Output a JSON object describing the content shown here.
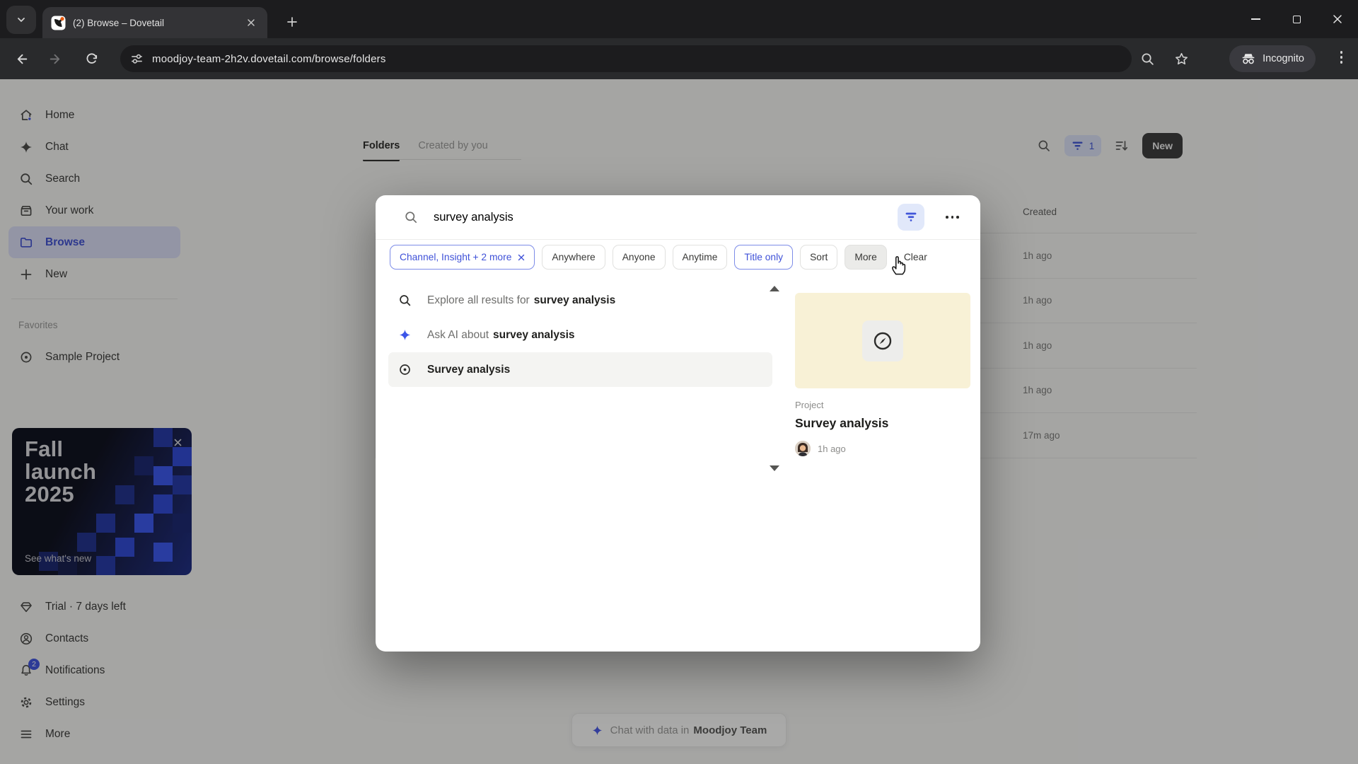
{
  "browser": {
    "tab_title": "(2) Browse – Dovetail",
    "url": "moodjoy-team-2h2v.dovetail.com/browse/folders",
    "incognito_label": "Incognito"
  },
  "sidebar": {
    "items": [
      {
        "label": "Home",
        "icon": "home-icon"
      },
      {
        "label": "Chat",
        "icon": "sparkle-icon"
      },
      {
        "label": "Search",
        "icon": "search-icon"
      },
      {
        "label": "Your work",
        "icon": "work-box-icon"
      },
      {
        "label": "Browse",
        "icon": "folder-icon",
        "active": true
      },
      {
        "label": "New",
        "icon": "plus-icon"
      }
    ],
    "favorites_label": "Favorites",
    "favorites": [
      {
        "label": "Sample Project",
        "icon": "target-icon"
      }
    ],
    "banner": {
      "title_line1": "Fall",
      "title_line2": "launch",
      "title_line3": "2025",
      "link": "See what's new"
    },
    "footer_items": [
      {
        "label": "Trial · 7 days left",
        "icon": "gem-icon"
      },
      {
        "label": "Contacts",
        "icon": "person-circle-icon"
      },
      {
        "label": "Notifications",
        "icon": "bell-icon",
        "badge": "2"
      },
      {
        "label": "Settings",
        "icon": "gear-icon"
      },
      {
        "label": "More",
        "icon": "hamburger-icon"
      }
    ]
  },
  "main": {
    "tabs": [
      {
        "label": "Folders",
        "active": true
      },
      {
        "label": "Created by you"
      }
    ],
    "toolbar": {
      "filter_count": "1",
      "new_button": "New"
    },
    "table": {
      "created_header": "Created",
      "rows": [
        {
          "created": "1h ago"
        },
        {
          "created": "1h ago"
        },
        {
          "created": "1h ago"
        },
        {
          "created": "1h ago"
        },
        {
          "created": "17m ago"
        }
      ]
    },
    "chat_bar": {
      "prefix": "Chat with data in",
      "team": "Moodjoy Team"
    }
  },
  "modal": {
    "search_value": "survey analysis",
    "chips": [
      {
        "label": "Channel, Insight + 2 more",
        "removable": true,
        "active": true
      },
      {
        "label": "Anywhere"
      },
      {
        "label": "Anyone"
      },
      {
        "label": "Anytime"
      },
      {
        "label": "Title only",
        "active": true
      },
      {
        "label": "Sort"
      },
      {
        "label": "More",
        "hover": true
      },
      {
        "label": "Clear",
        "plain": true
      }
    ],
    "results": [
      {
        "prefix": "Explore all results for",
        "query": "survey analysis",
        "icon": "search-icon"
      },
      {
        "prefix": "Ask AI about",
        "query": "survey analysis",
        "icon": "sparkle-icon"
      },
      {
        "title": "Survey analysis",
        "icon": "target-icon",
        "selected": true
      }
    ],
    "preview": {
      "type_label": "Project",
      "title": "Survey analysis",
      "time": "1h ago"
    }
  },
  "colors": {
    "accent_blue": "#3f51d8",
    "banner_bg": "#0c0e1c",
    "thumb_cream": "#f8f1d6"
  }
}
